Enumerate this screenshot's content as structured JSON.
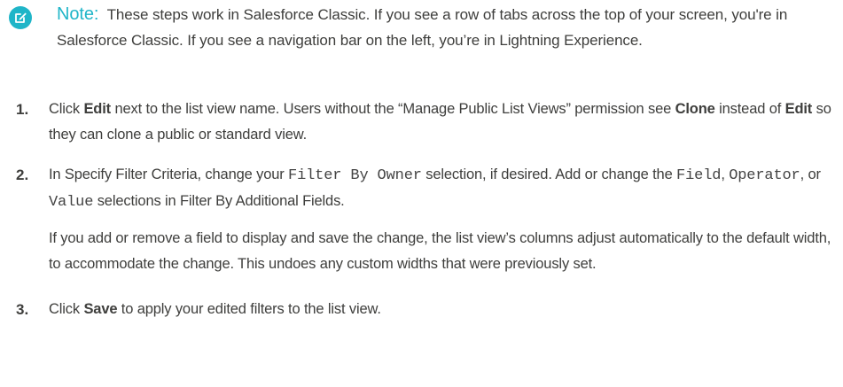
{
  "note": {
    "icon": "edit-note-icon",
    "accent_color": "#1fb5c8",
    "label": "Note:",
    "text": "These steps work in Salesforce Classic. If you see a row of tabs across the top of your screen, you're in Salesforce Classic. If you see a navigation bar on the left, you’re in Lightning Experience."
  },
  "steps": [
    {
      "number": "1.",
      "p1": {
        "t1": "Click ",
        "b1": "Edit",
        "t2": " next to the list view name. Users without the “Manage Public List Views” permission see ",
        "b2": "Clone",
        "t3": " instead of ",
        "b3": "Edit",
        "t4": " so they can clone a public or standard view."
      }
    },
    {
      "number": "2.",
      "p1": {
        "t1": "In Specify Filter Criteria, change your ",
        "c1": "Filter By Owner",
        "t2": " selection, if desired. Add or change the ",
        "c2": "Field",
        "t3": ", ",
        "c3": "Operator",
        "t4": ", or ",
        "c4": "Value",
        "t5": " selections in Filter By Additional Fields."
      },
      "p2": "If you add or remove a field to display and save the change, the list view’s columns adjust automatically to the default width, to accommodate the change. This undoes any custom widths that were previously set."
    },
    {
      "number": "3.",
      "p1": {
        "t1": "Click ",
        "b1": "Save",
        "t2": " to apply your edited filters to the list view."
      }
    }
  ]
}
